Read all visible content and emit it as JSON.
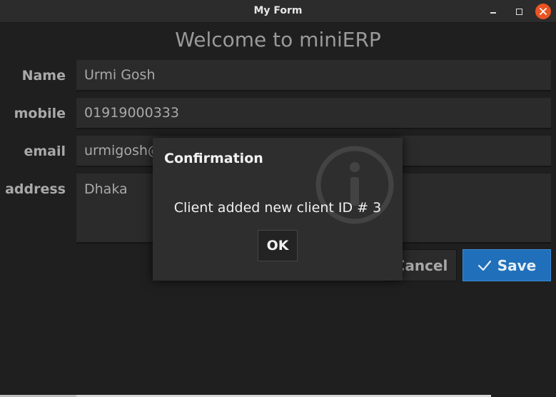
{
  "window": {
    "title": "My Form"
  },
  "form": {
    "heading": "Welcome to miniERP",
    "fields": [
      {
        "label": "Name",
        "value": "Urmi Gosh"
      },
      {
        "label": "mobile",
        "value": "01919000333"
      },
      {
        "label": "email",
        "value": "urmigosh@"
      },
      {
        "label": "address",
        "value": "Dhaka"
      }
    ],
    "cancel_label": "Cancel",
    "save_label": "Save"
  },
  "dialog": {
    "title": "Confirmation",
    "message": "Client added new client ID # 3",
    "ok_label": "OK",
    "icon": "info-icon"
  },
  "colors": {
    "background": "#1f1f1f",
    "accent": "#1f6fba",
    "close": "#e95420"
  }
}
